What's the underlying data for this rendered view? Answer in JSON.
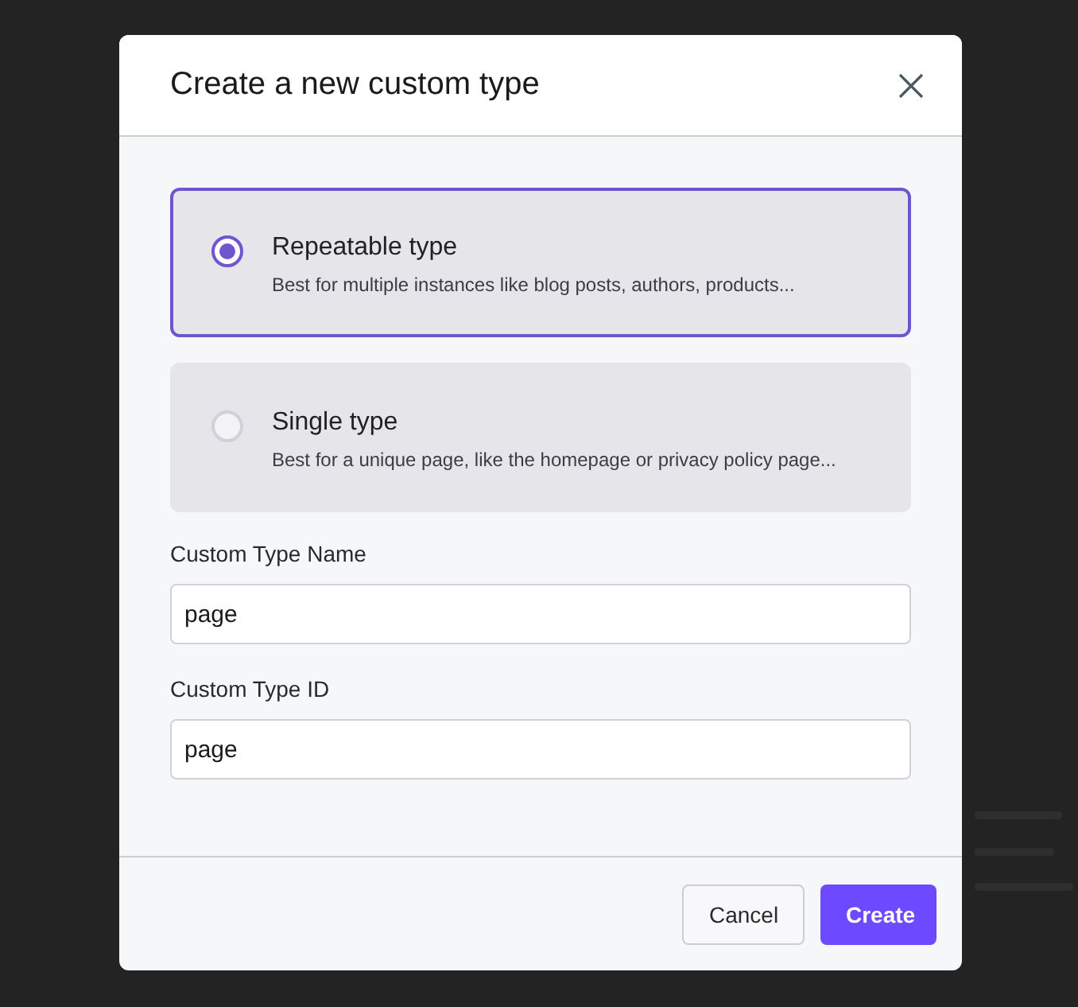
{
  "dialog": {
    "title": "Create a new custom type",
    "options": [
      {
        "label": "Repeatable type",
        "description": "Best for multiple instances like blog posts, authors, products...",
        "selected": true
      },
      {
        "label": "Single type",
        "description": "Best for a unique page, like the homepage or privacy policy page...",
        "selected": false
      }
    ],
    "fields": [
      {
        "label": "Custom Type Name",
        "value": "page"
      },
      {
        "label": "Custom Type ID",
        "value": "page"
      }
    ],
    "buttons": [
      {
        "label": "Cancel",
        "kind": "secondary"
      },
      {
        "label": "Create",
        "kind": "primary"
      }
    ]
  }
}
